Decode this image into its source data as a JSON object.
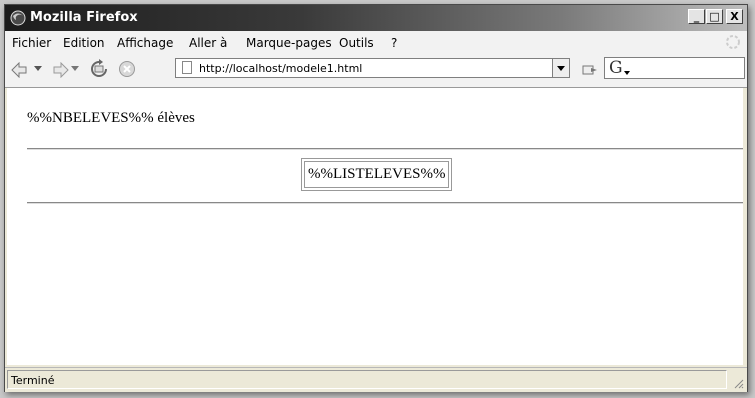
{
  "window": {
    "title": "Mozilla Firefox"
  },
  "window_controls": {
    "minimize": "_",
    "maximize": "□",
    "close": "X"
  },
  "menu": [
    {
      "label": "Fichier"
    },
    {
      "label": "Edition"
    },
    {
      "label": "Affichage"
    },
    {
      "label": "Aller à"
    },
    {
      "label": "Marque-pages"
    },
    {
      "label": "Outils"
    },
    {
      "label": "?"
    }
  ],
  "toolbar": {
    "url": "http://localhost/modele1.html",
    "search_engine_icon": "google-icon",
    "search_engine_glyph": "G"
  },
  "page": {
    "count_text": "%%NBELEVES%% élèves",
    "list_cell": "%%LISTELEVES%%"
  },
  "status": {
    "text": "Terminé"
  },
  "colors": {
    "titlebar_start": "#1c1c1c",
    "titlebar_end": "#bdbdbd",
    "chrome": "#ece9d8"
  }
}
